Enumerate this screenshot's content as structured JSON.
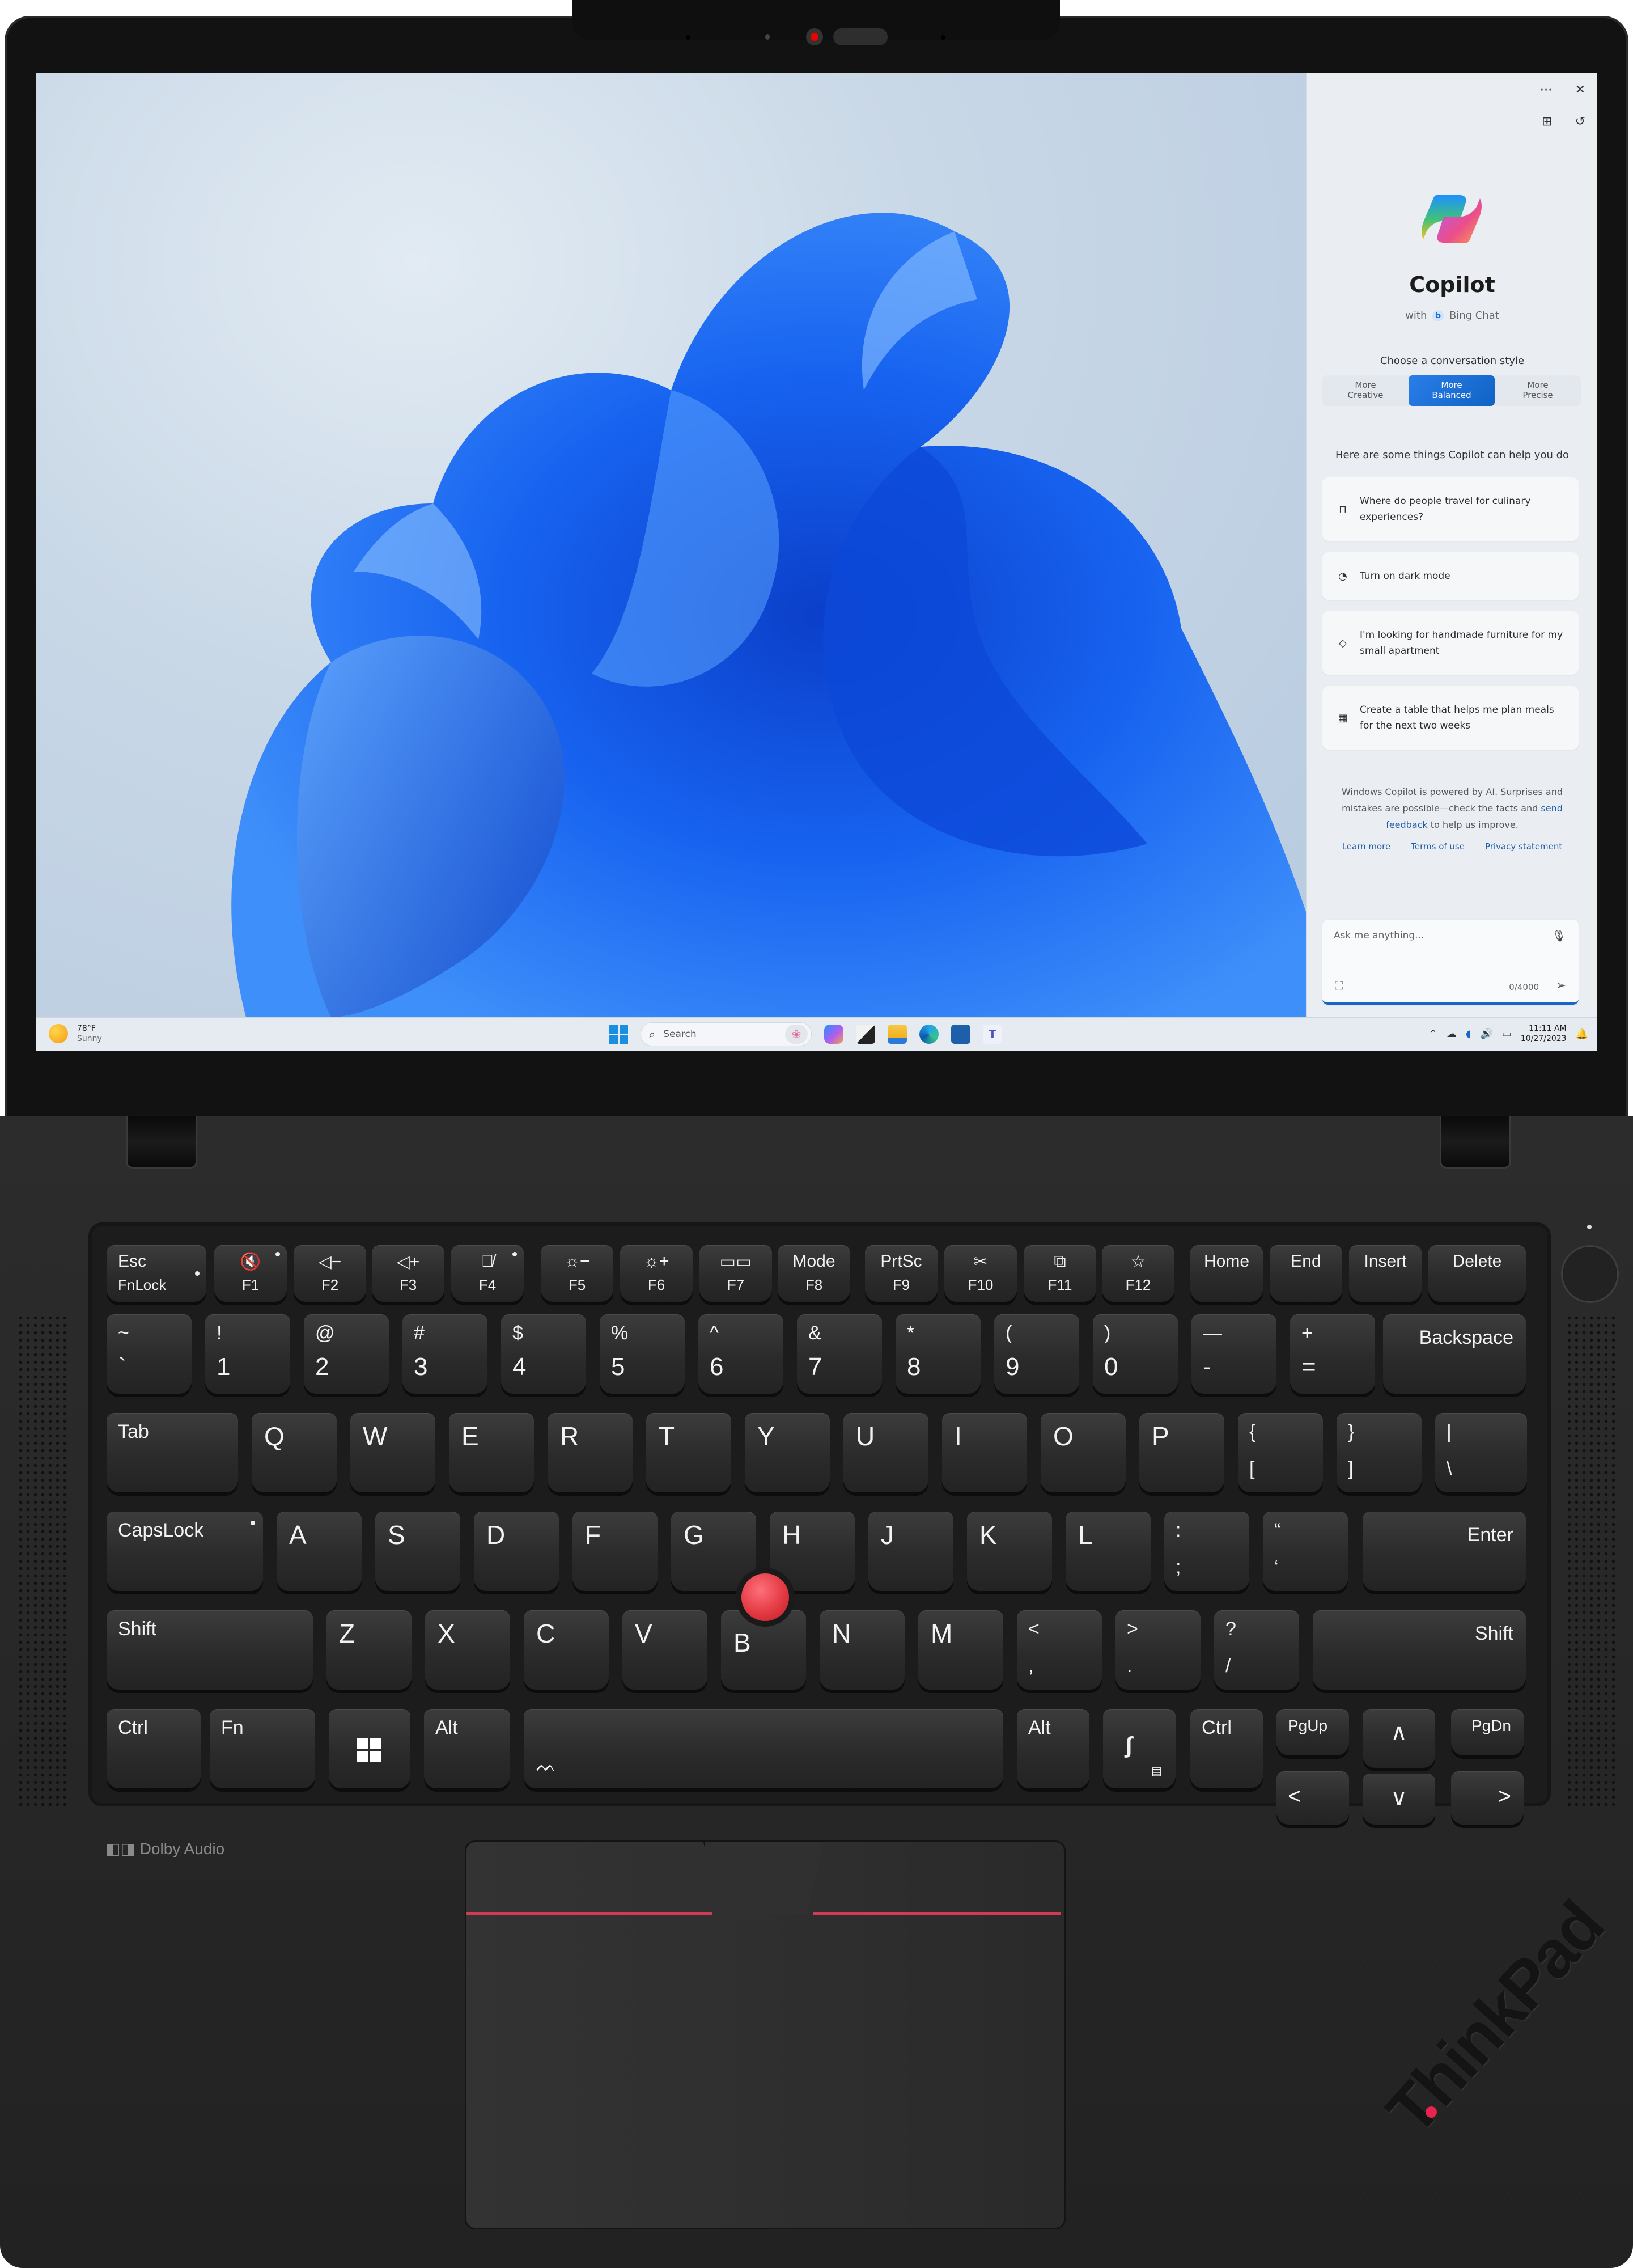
{
  "copilot": {
    "menu_icon": "more-options-icon",
    "close_icon": "close-icon",
    "widgets_icon": "plugins-icon",
    "history_icon": "history-icon",
    "title": "Copilot",
    "subtitle_with": "with",
    "subtitle_brand": "Bing Chat",
    "choose_label": "Choose a conversation style",
    "styles": [
      {
        "line1": "More",
        "line2": "Creative",
        "active": false
      },
      {
        "line1": "More",
        "line2": "Balanced",
        "active": true
      },
      {
        "line1": "More",
        "line2": "Precise",
        "active": false
      }
    ],
    "help_label": "Here are some things Copilot can help you do",
    "suggestions": [
      {
        "icon": "briefcase-icon",
        "text": "Where do people travel for culinary experiences?"
      },
      {
        "icon": "palette-icon",
        "text": "Turn on dark mode"
      },
      {
        "icon": "tag-icon",
        "text": "I'm looking for handmade furniture for my small apartment"
      },
      {
        "icon": "table-icon",
        "text": "Create a table that helps me plan meals for the next two weeks"
      }
    ],
    "disclaimer_1": "Windows Copilot is powered by AI. Surprises and mistakes are possible—check the facts and",
    "disclaimer_link": "send feedback",
    "disclaimer_2": "to help us improve.",
    "links": [
      "Learn more",
      "Terms of use",
      "Privacy statement"
    ],
    "input_placeholder": "Ask me anything...",
    "char_count": "0/4000",
    "accent_color": "#1a66c8"
  },
  "taskbar": {
    "weather_temp": "78°F",
    "weather_cond": "Sunny",
    "search_placeholder": "Search",
    "apps": [
      "copilot",
      "task-view",
      "file-explorer",
      "edge",
      "microsoft-store",
      "teams"
    ],
    "time": "11:11 AM",
    "date": "10/27/2023"
  },
  "keyboard": {
    "fn_row": [
      {
        "top": "Esc",
        "bottom": "FnLock",
        "name": "esc"
      },
      {
        "top": "🔇",
        "bottom": "F1",
        "name": "f1"
      },
      {
        "top": "◁−",
        "bottom": "F2",
        "name": "f2"
      },
      {
        "top": "◁+",
        "bottom": "F3",
        "name": "f3"
      },
      {
        "top": "🎙̸",
        "bottom": "F4",
        "name": "f4"
      },
      {
        "top": "☼−",
        "bottom": "F5",
        "name": "f5"
      },
      {
        "top": "☼+",
        "bottom": "F6",
        "name": "f6"
      },
      {
        "top": "▭▭",
        "bottom": "F7",
        "name": "f7"
      },
      {
        "top": "Mode",
        "bottom": "F8",
        "name": "f8"
      },
      {
        "top": "PrtSc",
        "bottom": "F9",
        "name": "f9"
      },
      {
        "top": "✂",
        "bottom": "F10",
        "name": "f10"
      },
      {
        "top": "⧉",
        "bottom": "F11",
        "name": "f11"
      },
      {
        "top": "☆",
        "bottom": "F12",
        "name": "f12"
      },
      {
        "top": "Home",
        "bottom": "",
        "name": "home"
      },
      {
        "top": "End",
        "bottom": "",
        "name": "end"
      },
      {
        "top": "Insert",
        "bottom": "",
        "name": "insert"
      },
      {
        "top": "Delete",
        "bottom": "",
        "name": "delete"
      }
    ],
    "num_row": [
      {
        "top": "~",
        "bottom": "`"
      },
      {
        "top": "!",
        "bottom": "1"
      },
      {
        "top": "@",
        "bottom": "2"
      },
      {
        "top": "#",
        "bottom": "3"
      },
      {
        "top": "$",
        "bottom": "4"
      },
      {
        "top": "%",
        "bottom": "5"
      },
      {
        "top": "^",
        "bottom": "6"
      },
      {
        "top": "&",
        "bottom": "7"
      },
      {
        "top": "*",
        "bottom": "8"
      },
      {
        "top": "(",
        "bottom": "9"
      },
      {
        "top": ")",
        "bottom": "0"
      },
      {
        "top": "—",
        "bottom": "-"
      },
      {
        "top": "+",
        "bottom": "="
      }
    ],
    "backspace": "Backspace",
    "tab": "Tab",
    "qwerty": [
      "Q",
      "W",
      "E",
      "R",
      "T",
      "Y",
      "U",
      "I",
      "O",
      "P"
    ],
    "brackets": [
      {
        "top": "{",
        "bottom": "["
      },
      {
        "top": "}",
        "bottom": "]"
      },
      {
        "top": "|",
        "bottom": "\\"
      }
    ],
    "capslock": "CapsLock",
    "home_row": [
      "A",
      "S",
      "D",
      "F",
      "G",
      "H",
      "J",
      "K",
      "L"
    ],
    "home_punct": [
      {
        "top": ":",
        "bottom": ";"
      },
      {
        "top": "“",
        "bottom": "‘"
      }
    ],
    "enter": "Enter",
    "shift_left": "Shift",
    "bottom_row": [
      "Z",
      "X",
      "C",
      "V",
      "B",
      "N",
      "M"
    ],
    "bottom_punct": [
      {
        "top": "<",
        "bottom": ","
      },
      {
        "top": ">",
        "bottom": "."
      },
      {
        "top": "?",
        "bottom": "/"
      }
    ],
    "shift_right": "Shift",
    "ctrl_left": "Ctrl",
    "fn": "Fn",
    "alt_left": "Alt",
    "alt_right": "Alt",
    "ctrl_right": "Ctrl",
    "pgup": "PgUp",
    "pgdn": "PgDn",
    "arrow_up": "∧",
    "arrow_down": "∨",
    "arrow_left": "<",
    "arrow_right": ">"
  },
  "branding": {
    "dolby": "Dolby Audio",
    "logo": "ThinkPad"
  }
}
